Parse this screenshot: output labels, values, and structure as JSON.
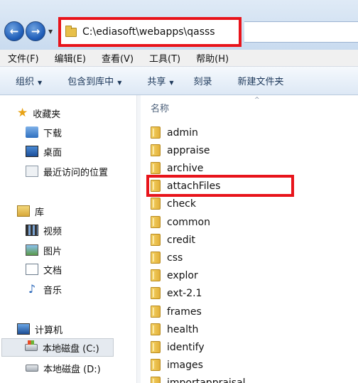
{
  "address": {
    "path": "C:\\ediasoft\\webapps\\qasss"
  },
  "nav_buttons": {
    "back": "←",
    "forward": "→",
    "dropdown": "▼"
  },
  "menu": [
    "文件(F)",
    "编辑(E)",
    "查看(V)",
    "工具(T)",
    "帮助(H)"
  ],
  "toolbar": {
    "organize": "组织",
    "include_library": "包含到库中",
    "share": "共享",
    "burn": "刻录",
    "new_folder": "新建文件夹",
    "caret": "▼"
  },
  "sidebar": {
    "favorites": {
      "label": "收藏夹",
      "items": [
        "下载",
        "桌面",
        "最近访问的位置"
      ]
    },
    "libraries": {
      "label": "库",
      "items": [
        "视频",
        "图片",
        "文档",
        "音乐"
      ]
    },
    "computer": {
      "label": "计算机",
      "drives": [
        "本地磁盘 (C:)",
        "本地磁盘 (D:)"
      ]
    }
  },
  "content": {
    "column_header": "名称",
    "sort_indicator": "^",
    "files": [
      "admin",
      "appraise",
      "archive",
      "attachFiles",
      "check",
      "common",
      "credit",
      "css",
      "explor",
      "ext-2.1",
      "frames",
      "health",
      "identify",
      "images",
      "importappraisal"
    ]
  },
  "colors": {
    "highlight": "#e8141b",
    "folder": "#e3b13a"
  }
}
